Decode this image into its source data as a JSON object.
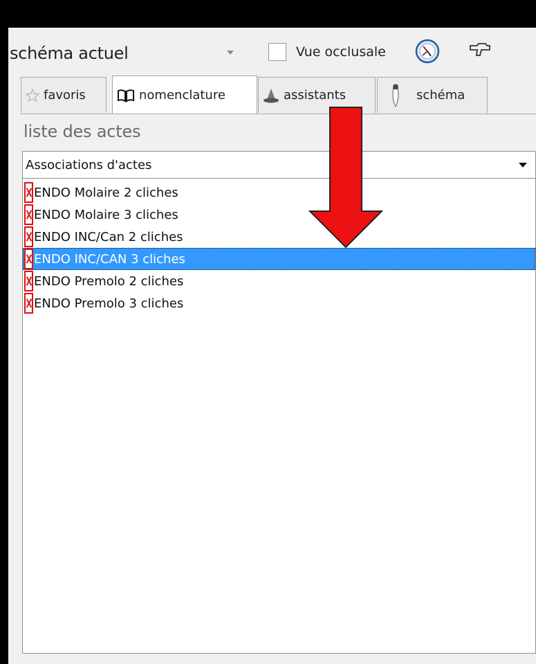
{
  "toolbar": {
    "view_select_value": "schéma actuel",
    "occlusal_checkbox_label": "Vue occlusale",
    "occlusal_checked": false,
    "icons": [
      "clock-icon",
      "tool-icon"
    ]
  },
  "tabs": [
    {
      "label": "favoris",
      "icon": "star-icon",
      "active": false
    },
    {
      "label": "nomenclature",
      "icon": "book-icon",
      "active": true
    },
    {
      "label": "assistants",
      "icon": "wizard-hat-icon",
      "active": false
    },
    {
      "label": "schéma",
      "icon": "tooth-icon",
      "active": false
    }
  ],
  "acts": {
    "title": "liste des actes",
    "filter_value": "Associations d'actes",
    "items": [
      {
        "label": "ENDO Molaire 2 cliches",
        "selected": false
      },
      {
        "label": "ENDO Molaire 3 cliches",
        "selected": false
      },
      {
        "label": "ENDO INC/Can 2 cliches",
        "selected": false
      },
      {
        "label": "ENDO INC/CAN 3 cliches",
        "selected": true
      },
      {
        "label": "ENDO Premolo 2 cliches",
        "selected": false
      },
      {
        "label": "ENDO Premolo 3 cliches",
        "selected": false
      }
    ]
  },
  "colors": {
    "selection": "#3399ff",
    "annotation_arrow": "#ee1111",
    "item_icon": "#e01010"
  }
}
